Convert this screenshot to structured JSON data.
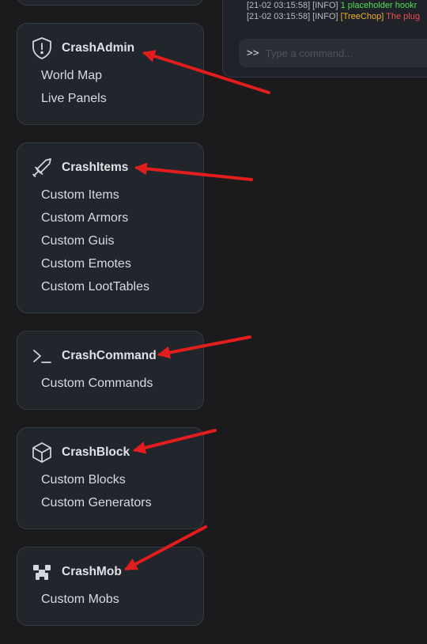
{
  "console": {
    "lines": [
      {
        "prefix": "[21-02 03:15:58] [INFO] ",
        "text": "1 placeholder hookr",
        "color": "#52e052"
      },
      {
        "prefix": "[21-02 03:15:58] [INFO] ",
        "bracket": "[",
        "tag": "TreeChop",
        "bracket_close": "] ",
        "tag_color": "#f0b030",
        "text": "The plug",
        "color": "#e85050"
      }
    ],
    "prompt": ">>",
    "placeholder": "Type a command..."
  },
  "cards": [
    {
      "title": "CrashAdmin",
      "icon": "shield-icon",
      "items": [
        "World Map",
        "Live Panels"
      ]
    },
    {
      "title": "CrashItems",
      "icon": "sword-icon",
      "items": [
        "Custom Items",
        "Custom Armors",
        "Custom Guis",
        "Custom Emotes",
        "Custom LootTables"
      ]
    },
    {
      "title": "CrashCommand",
      "icon": "terminal-icon",
      "items": [
        "Custom Commands"
      ]
    },
    {
      "title": "CrashBlock",
      "icon": "cube-icon",
      "items": [
        "Custom Blocks",
        "Custom Generators"
      ]
    },
    {
      "title": "CrashMob",
      "icon": "creeper-icon",
      "items": [
        "Custom Mobs"
      ]
    }
  ],
  "colors": {
    "background": "#1b1b1d",
    "card": "#21252c",
    "arrow": "#e11d1d"
  }
}
